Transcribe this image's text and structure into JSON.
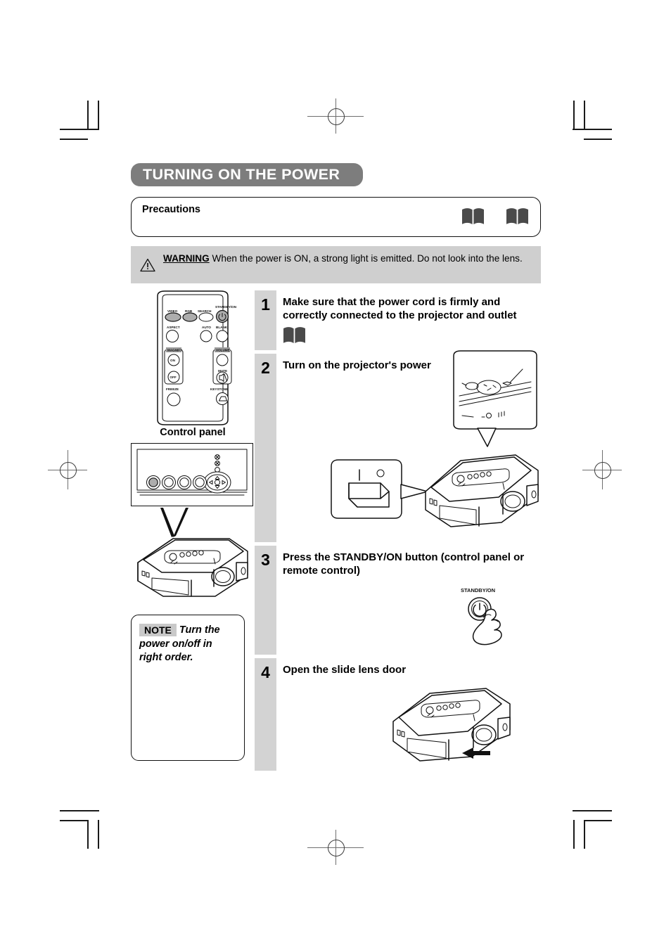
{
  "document": {
    "title": "TURNING ON THE POWER"
  },
  "precautions": {
    "label": "Precautions",
    "book_icons": [
      "book-icon",
      "book-icon"
    ]
  },
  "warning": {
    "icon": "warning-triangle-icon",
    "keyword": "WARNING",
    "text": "When the power is ON, a strong light is emitted. Do not look into the lens."
  },
  "remote": {
    "name": "remote-control-illustration",
    "buttons": [
      {
        "label": "VIDEO",
        "shape": "oval",
        "filled": true
      },
      {
        "label": "RGB",
        "shape": "oval",
        "filled": true
      },
      {
        "label": "SEARCH",
        "shape": "oval",
        "filled": false
      },
      {
        "label": "STANDBY/ON",
        "shape": "circle",
        "filled": true,
        "glyph": "power"
      },
      {
        "label": "ASPECT",
        "shape": "circle",
        "filled": false
      },
      {
        "label": "AUTO",
        "shape": "circle",
        "filled": false
      },
      {
        "label": "BLANK",
        "shape": "circle",
        "filled": false
      },
      {
        "label": "MAGNIFY",
        "shape": "group"
      },
      {
        "label": "ON",
        "shape": "circle",
        "filled": false
      },
      {
        "label": "OFF",
        "shape": "circle",
        "filled": false
      },
      {
        "label": "FREEZE",
        "shape": "circle",
        "filled": false
      },
      {
        "label": "VOLUME",
        "shape": "circle",
        "filled": false
      },
      {
        "label": "MUTE",
        "shape": "circle",
        "filled": false,
        "glyph": "mute"
      },
      {
        "label": "KEYSTONE",
        "shape": "circle",
        "filled": false,
        "glyph": "keystone"
      }
    ]
  },
  "control_panel": {
    "caption": "Control panel",
    "indicator_count": 3,
    "round_buttons": 4,
    "dpad": {
      "up": "▲",
      "down": "▼",
      "left": "◀",
      "right": "▶"
    }
  },
  "note": {
    "badge": "NOTE",
    "text": "Turn the power on/off in right order."
  },
  "steps": [
    {
      "number": "1",
      "title": "Make sure that the power cord is firmly and correctly connected to the projector and outlet",
      "has_book_icon": true,
      "art": "none"
    },
    {
      "number": "2",
      "title": "Turn on the projector's power",
      "has_book_icon": false,
      "art": "projector-with-power-switch-callouts"
    },
    {
      "number": "3",
      "title": "Press the STANDBY/ON button (control panel or remote control)",
      "has_book_icon": false,
      "art": "hand-pressing-standby-on-button",
      "art_label": "STANDBY/ON"
    },
    {
      "number": "4",
      "title": "Open the slide lens door",
      "has_book_icon": false,
      "art": "projector-with-slide-door-arrow"
    }
  ],
  "colors": {
    "title_pill_bg": "#7d7d7d",
    "warning_band_bg": "#cfcfcf",
    "step_number_bg": "#d3d3d3",
    "book_icon": "#4a4a4a",
    "note_badge_bg": "#c9c9c9"
  }
}
